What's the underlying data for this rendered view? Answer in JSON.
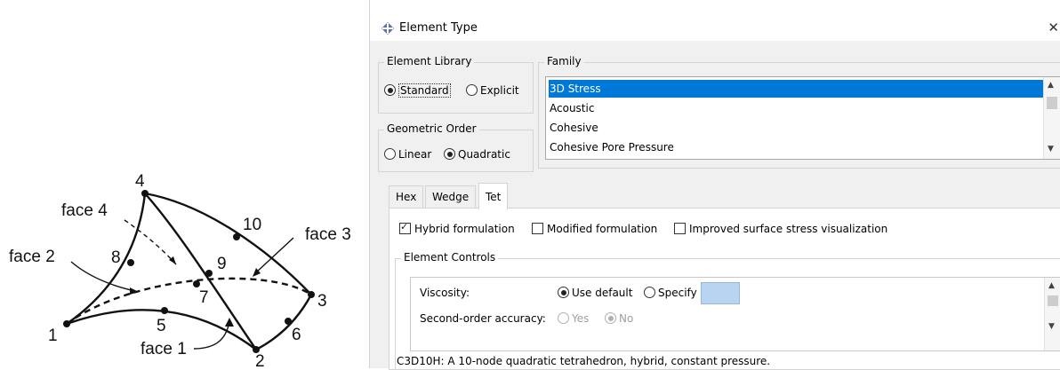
{
  "diagram": {
    "nodes": [
      "1",
      "2",
      "3",
      "4",
      "5",
      "6",
      "7",
      "8",
      "9",
      "10"
    ],
    "faces": [
      "face 1",
      "face 2",
      "face 3",
      "face 4"
    ]
  },
  "dialog": {
    "title": "Element Type",
    "close_icon": "close-icon",
    "element_library": {
      "title": "Element Library",
      "options": [
        "Standard",
        "Explicit"
      ],
      "selected": "Standard"
    },
    "family": {
      "title": "Family",
      "items": [
        "3D Stress",
        "Acoustic",
        "Cohesive",
        "Cohesive Pore Pressure"
      ],
      "selected": "3D Stress"
    },
    "geometric_order": {
      "title": "Geometric Order",
      "options": [
        "Linear",
        "Quadratic"
      ],
      "selected": "Quadratic"
    },
    "tabs": [
      "Hex",
      "Wedge",
      "Tet"
    ],
    "active_tab": "Tet",
    "checkboxes": [
      {
        "label": "Hybrid formulation",
        "checked": true
      },
      {
        "label": "Modified formulation",
        "checked": false
      },
      {
        "label": "Improved surface stress visualization",
        "checked": false
      }
    ],
    "element_controls": {
      "title": "Element Controls",
      "viscosity": {
        "label": "Viscosity:",
        "options": [
          "Use default",
          "Specify"
        ],
        "selected": "Use default"
      },
      "second_order": {
        "label": "Second-order accuracy:",
        "options": [
          "Yes",
          "No"
        ],
        "selected": "No"
      },
      "swatch_color": "#b8d4f0"
    },
    "description": "C3D10H:  A 10-node quadratic tetrahedron, hybrid, constant pressure."
  }
}
